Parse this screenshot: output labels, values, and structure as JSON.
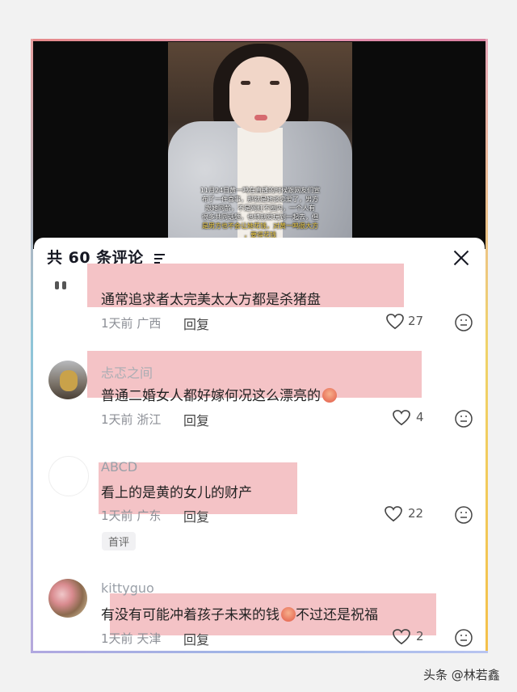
{
  "video": {
    "caption_line1": "11月24日黄一鸣在直播的时候跟网友们宣",
    "caption_line2": "布了一件喜事，那就是她谈恋爱了，男方",
    "caption_line3": "跟她同龄，不是网红不圈内，一个人有",
    "caption_line4": "很多共同话题，也特别爱玩到一起去，但",
    "caption_line5": "是男方也不会让她花钱，对黄一鸣很大方",
    "caption_line6": "，要得花钱"
  },
  "panel": {
    "title": "共 60 条评论"
  },
  "comments": [
    {
      "text": "通常追求者太完美太大方都是杀猪盘",
      "time": "1天前",
      "location": "广西",
      "reply": "回复",
      "likes": "27"
    },
    {
      "username": "忐忑之间",
      "text": "普通二婚女人都好嫁何况这么漂亮的",
      "time": "1天前",
      "location": "浙江",
      "reply": "回复",
      "likes": "4"
    },
    {
      "username": "ABCD",
      "text": "看上的是黄的女儿的财产",
      "time": "1天前",
      "location": "广东",
      "reply": "回复",
      "likes": "22",
      "badge": "首评"
    },
    {
      "username": "kittyguo",
      "text_a": "有没有可能冲着孩子未来的钱",
      "text_b": "不过还是祝福",
      "time": "1天前",
      "location": "天津",
      "reply": "回复",
      "likes": "2"
    }
  ],
  "watermark": "头条 @林若鑫",
  "colors": {
    "highlight": "#f3c0c3",
    "accent_caption": "#f2d04a"
  }
}
